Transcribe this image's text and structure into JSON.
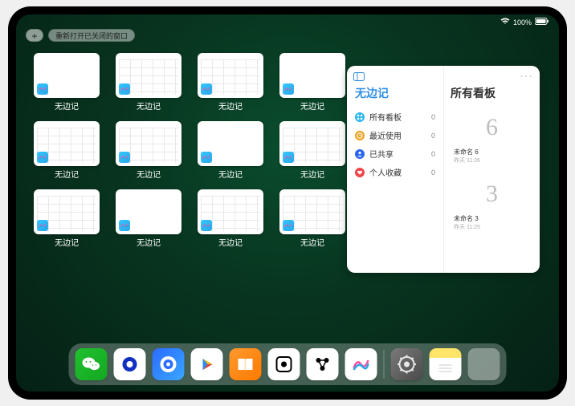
{
  "status": {
    "battery": "100%"
  },
  "top": {
    "plus": "+",
    "reopen": "重新打开已关闭的窗口"
  },
  "windows": [
    {
      "label": "无边记",
      "variant": "blank"
    },
    {
      "label": "无边记",
      "variant": "grid"
    },
    {
      "label": "无边记",
      "variant": "grid"
    },
    {
      "label": "无边记",
      "variant": "blank"
    },
    {
      "label": "无边记",
      "variant": "grid"
    },
    {
      "label": "无边记",
      "variant": "grid"
    },
    {
      "label": "无边记",
      "variant": "blank"
    },
    {
      "label": "无边记",
      "variant": "grid"
    },
    {
      "label": "无边记",
      "variant": "grid"
    },
    {
      "label": "无边记",
      "variant": "blank"
    },
    {
      "label": "无边记",
      "variant": "grid"
    },
    {
      "label": "无边记",
      "variant": "grid"
    }
  ],
  "panel": {
    "left_title": "无边记",
    "right_title": "所有看板",
    "more": "···",
    "nav": [
      {
        "icon": "grid",
        "color": "#2bb7f0",
        "label": "所有看板",
        "count": "0"
      },
      {
        "icon": "clock",
        "color": "#f0a020",
        "label": "最近使用",
        "count": "0"
      },
      {
        "icon": "person",
        "color": "#2b66f0",
        "label": "已共享",
        "count": "0"
      },
      {
        "icon": "heart",
        "color": "#f04648",
        "label": "个人收藏",
        "count": "0"
      }
    ],
    "boards": [
      {
        "glyph": "6",
        "name": "未命名 6",
        "sub": "昨天 11:26"
      },
      {
        "glyph": "3",
        "name": "未命名 3",
        "sub": "昨天 11:25"
      }
    ]
  },
  "dock": {
    "items": [
      {
        "name": "wechat",
        "bg": "linear-gradient(135deg,#20c12e,#14a722)",
        "fg": "#fff"
      },
      {
        "name": "quark",
        "bg": "#ffffff",
        "fg": "#1030c0"
      },
      {
        "name": "browser",
        "bg": "linear-gradient(135deg,#2a6cff,#3aa6ff)",
        "fg": "#fff"
      },
      {
        "name": "play",
        "bg": "#ffffff",
        "fg": "#000"
      },
      {
        "name": "books",
        "bg": "linear-gradient(135deg,#ff9a2f,#ff7a00)",
        "fg": "#fff"
      },
      {
        "name": "game",
        "bg": "#ffffff",
        "fg": "#000"
      },
      {
        "name": "nodes",
        "bg": "#ffffff",
        "fg": "#000"
      },
      {
        "name": "freeform",
        "bg": "#ffffff",
        "fg": "#000"
      },
      {
        "name": "settings",
        "bg": "linear-gradient(135deg,#7a7a7a,#4a4a4a)",
        "fg": "#e8e8e8"
      },
      {
        "name": "notes",
        "bg": "linear-gradient(#ffe46a 30%,#fff 30%)",
        "fg": "#000"
      }
    ],
    "folder": {
      "name": "recent-folder"
    }
  }
}
